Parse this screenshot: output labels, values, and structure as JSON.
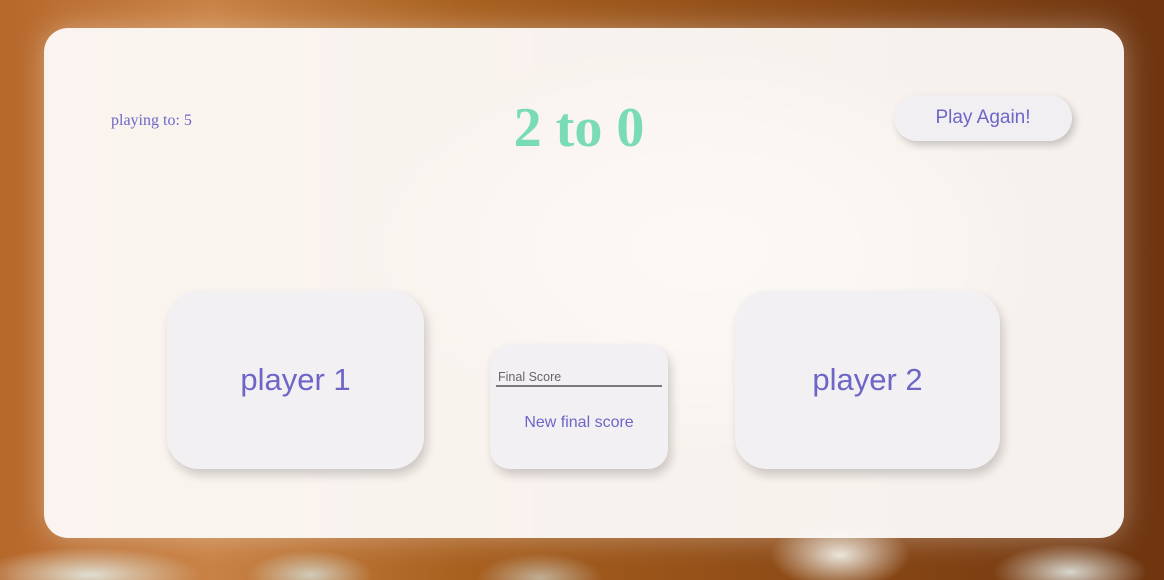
{
  "header": {
    "playing_to": "playing to: 5",
    "score": "2 to 0",
    "play_again_label": "Play Again!"
  },
  "players": {
    "player1_label": "player 1",
    "player2_label": "player 2"
  },
  "final_score": {
    "placeholder": "Final Score",
    "value": "",
    "button_label": "New final score"
  },
  "colors": {
    "accent_text": "#6d66c6",
    "score_text": "#79dcb4",
    "card_background": "#fcf9f7",
    "button_background": "#f2f0f3"
  }
}
